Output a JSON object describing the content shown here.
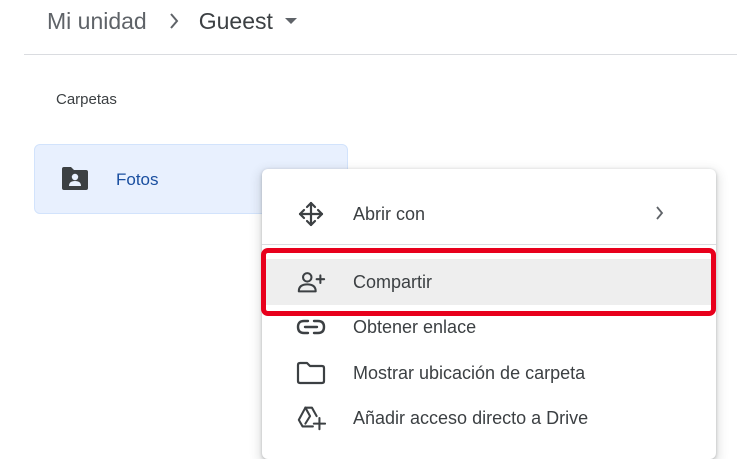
{
  "breadcrumb": {
    "root": "Mi unidad",
    "current": "Gueest"
  },
  "section": {
    "label": "Carpetas"
  },
  "folder": {
    "name": "Fotos",
    "icon": "shared-folder-icon"
  },
  "context_menu": {
    "items": [
      {
        "label": "Abrir con",
        "icon": "move-arrows-icon",
        "has_submenu": true
      },
      {
        "label": "Compartir",
        "icon": "person-add-icon",
        "highlighted": true
      },
      {
        "label": "Obtener enlace",
        "icon": "link-icon"
      },
      {
        "label": "Mostrar ubicación de carpeta",
        "icon": "folder-outline-icon"
      },
      {
        "label": "Añadir acceso directo a Drive",
        "icon": "drive-add-shortcut-icon"
      }
    ]
  },
  "colors": {
    "highlight_border": "#e8001c",
    "folder_card_bg": "#e8f0fe",
    "folder_text": "#1a4fa0",
    "hover_bg": "#eeeeee"
  }
}
